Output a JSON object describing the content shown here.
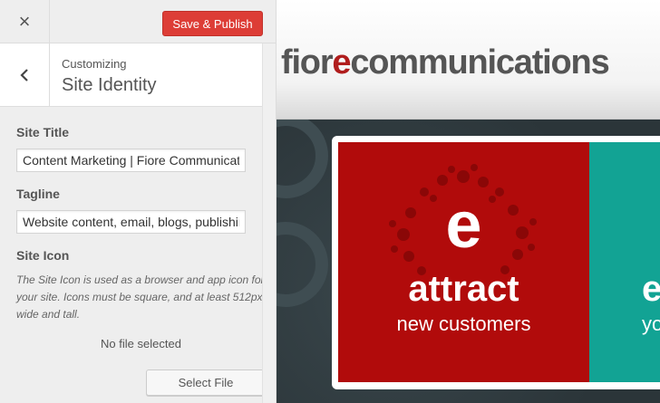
{
  "topbar": {
    "close_icon": "×",
    "publish_label": "Save & Publish",
    "publish_color": "#dd3d36"
  },
  "section": {
    "breadcrumb": "Customizing",
    "title": "Site Identity",
    "back_icon": "chevron-left-icon"
  },
  "fields": {
    "site_title_label": "Site Title",
    "site_title_value": "Content Marketing | Fiore Communications",
    "tagline_label": "Tagline",
    "tagline_value": "Website content, email, blogs, publishing",
    "site_icon_label": "Site Icon",
    "site_icon_desc": "The Site Icon is used as a browser and app icon for your site. Icons must be square, and at least 512px wide and tall.",
    "no_file_text": "No file selected",
    "select_file_label": "Select File"
  },
  "preview": {
    "logo_part1": "fior",
    "logo_e": "e",
    "logo_part2": "communications",
    "red_panel": {
      "e_letter": "e",
      "word": "attract",
      "sub": "new customers",
      "color": "#b10b0b"
    },
    "teal_panel": {
      "e_letter": "e",
      "sub": "yo",
      "color": "#12a394"
    }
  }
}
